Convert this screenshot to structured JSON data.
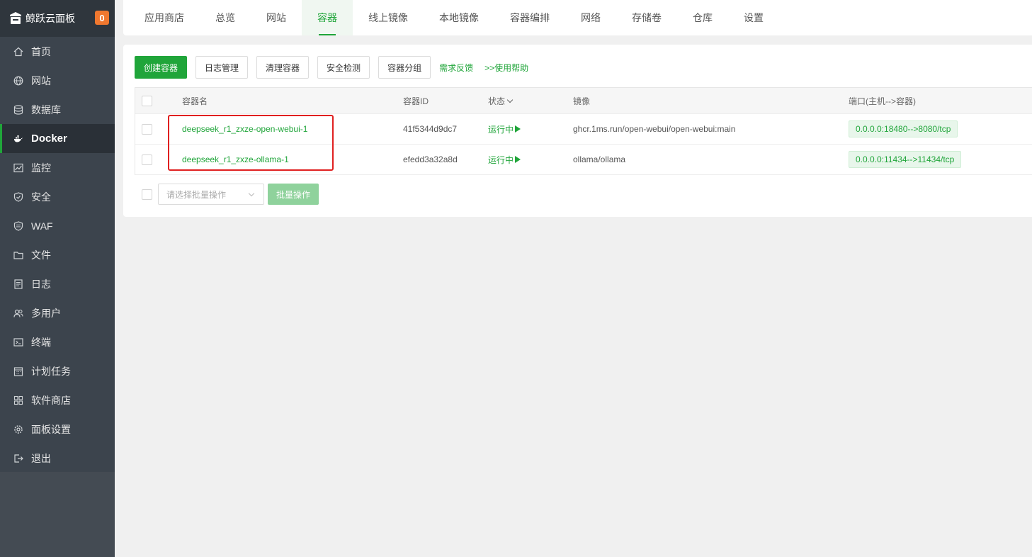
{
  "sidebar": {
    "brand": "鲸跃云面板",
    "badge": "0",
    "items": [
      {
        "label": "首页",
        "icon": "home-icon"
      },
      {
        "label": "网站",
        "icon": "globe-icon"
      },
      {
        "label": "数据库",
        "icon": "database-icon"
      },
      {
        "label": "Docker",
        "icon": "docker-icon"
      },
      {
        "label": "监控",
        "icon": "monitor-icon"
      },
      {
        "label": "安全",
        "icon": "shield-icon"
      },
      {
        "label": "WAF",
        "icon": "waf-shield-icon"
      },
      {
        "label": "文件",
        "icon": "folder-icon"
      },
      {
        "label": "日志",
        "icon": "log-icon"
      },
      {
        "label": "多用户",
        "icon": "users-icon"
      },
      {
        "label": "终端",
        "icon": "terminal-icon"
      },
      {
        "label": "计划任务",
        "icon": "calendar-icon"
      },
      {
        "label": "软件商店",
        "icon": "apps-icon"
      },
      {
        "label": "面板设置",
        "icon": "gear-icon"
      },
      {
        "label": "退出",
        "icon": "logout-icon"
      }
    ],
    "active_index": 3
  },
  "tabs": [
    "应用商店",
    "总览",
    "网站",
    "容器",
    "线上镜像",
    "本地镜像",
    "容器编排",
    "网络",
    "存储卷",
    "仓库",
    "设置"
  ],
  "active_tab": 3,
  "toolbar": {
    "create": "创建容器",
    "logs": "日志管理",
    "clean": "清理容器",
    "security": "安全检测",
    "group": "容器分组",
    "feedback": "需求反馈",
    "help": ">>使用帮助"
  },
  "table": {
    "headers": {
      "name": "容器名",
      "id": "容器ID",
      "status": "状态",
      "image": "镜像",
      "port": "端口(主机-->容器)"
    },
    "rows": [
      {
        "name": "deepseek_r1_zxze-open-webui-1",
        "id": "41f5344d9dc7",
        "status": "运行中",
        "image": "ghcr.1ms.run/open-webui/open-webui:main",
        "port": "0.0.0.0:18480-->8080/tcp"
      },
      {
        "name": "deepseek_r1_zxze-ollama-1",
        "id": "efedd3a32a8d",
        "status": "运行中",
        "image": "ollama/ollama",
        "port": "0.0.0.0:11434-->11434/tcp"
      }
    ]
  },
  "batch": {
    "placeholder": "请选择批量操作",
    "button": "批量操作"
  },
  "colors": {
    "accent": "#20a53a",
    "sidebar": "#3c444d",
    "badge": "#f0782f",
    "highlight": "#e02020"
  }
}
